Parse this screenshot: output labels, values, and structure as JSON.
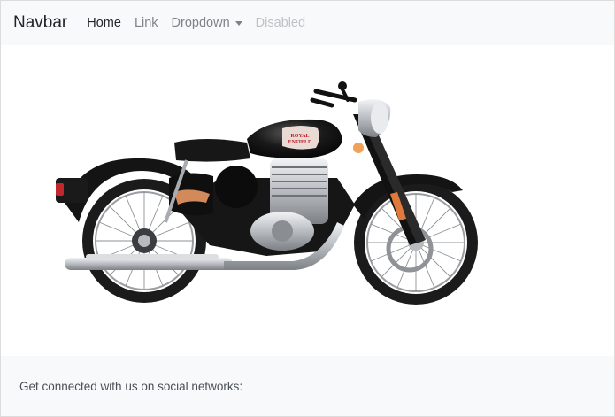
{
  "navbar": {
    "brand": "Navbar",
    "links": [
      {
        "label": "Home"
      },
      {
        "label": "Link"
      },
      {
        "label": "Dropdown"
      },
      {
        "label": "Disabled"
      }
    ]
  },
  "hero": {
    "image_alt": "Motorcycle",
    "tank_badge_line1": "ROYAL",
    "tank_badge_line2": "ENFIELD"
  },
  "footer": {
    "text": "Get connected with us on social networks:"
  },
  "colors": {
    "navbar_bg": "#f8f9fa",
    "footer_bg": "#f8f9fa",
    "bike_body": "#111111",
    "chrome": "#c9ccd0"
  }
}
